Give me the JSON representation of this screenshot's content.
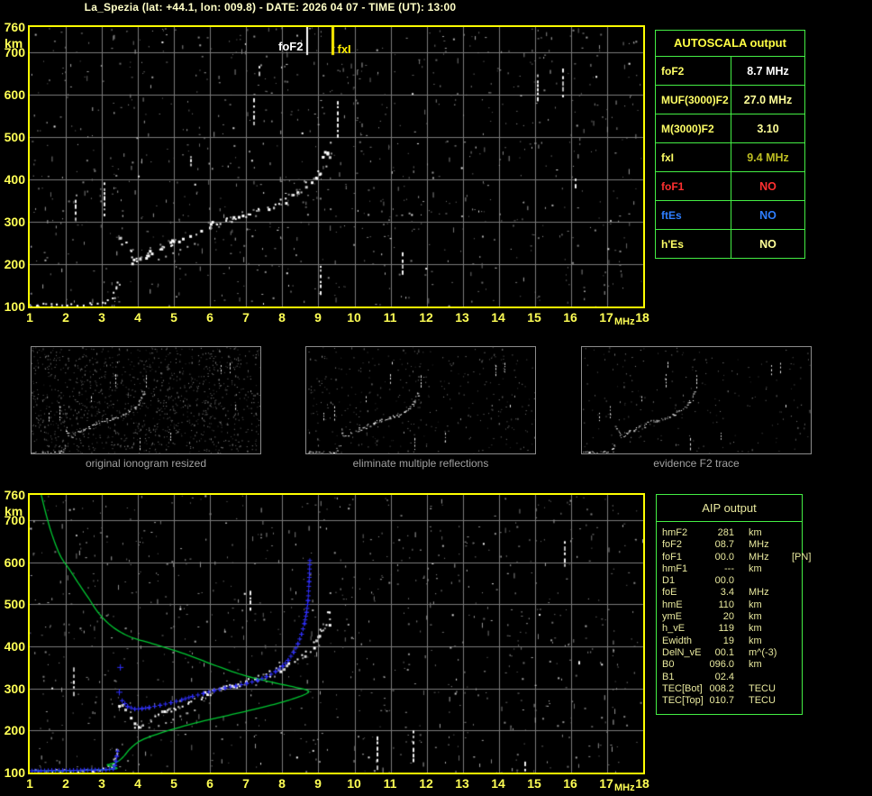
{
  "title": "La_Spezia (lat: +44.1, lon: 009.8) - DATE: 2026 04 07 - TIME (UT): 13:00",
  "colors": {
    "background": "#000000",
    "plot_border": "#ffff00",
    "grid": "#7b7b7b",
    "axis_label": "#ffff55",
    "title": "#ffffc6",
    "table_border": "#44ee44",
    "profile_green": "#00c832",
    "aip_trace_blue": "#3030ff",
    "echo_white": "#ffffff",
    "caption_gray": "#a0a0a0",
    "aip_text": "#e9e99e"
  },
  "autoscala_table": {
    "header": "AUTOSCALA output",
    "header_color": "#ffff44",
    "rows": [
      {
        "label": "foF2",
        "value": "8.7 MHz",
        "label_color": "#ffff66",
        "value_color": "#ffffff"
      },
      {
        "label": "MUF(3000)F2",
        "value": "27.0 MHz",
        "label_color": "#ffff66",
        "value_color": "#ffff99"
      },
      {
        "label": "M(3000)F2",
        "value": "3.10",
        "label_color": "#ffff66",
        "value_color": "#ffff99"
      },
      {
        "label": "fxI",
        "value": "9.4 MHz",
        "label_color": "#ffff66",
        "value_color": "#bdbd22"
      },
      {
        "label": "foF1",
        "value": "NO",
        "label_color": "#ff3030",
        "value_color": "#ff3030"
      },
      {
        "label": "ftEs",
        "value": "NO",
        "label_color": "#2e7eff",
        "value_color": "#2e7eff"
      },
      {
        "label": "h'Es",
        "value": "NO",
        "label_color": "#ffff66",
        "value_color": "#ffff99"
      }
    ]
  },
  "aip_table": {
    "header": "AIP output",
    "rows": [
      {
        "name": "hmF2",
        "value": "281",
        "unit": "km",
        "extra": ""
      },
      {
        "name": "foF2",
        "value": "08.7",
        "unit": "MHz",
        "extra": ""
      },
      {
        "name": "foF1",
        "value": "00.0",
        "unit": "MHz",
        "extra": "[PN]"
      },
      {
        "name": "hmF1",
        "value": "---",
        "unit": "km",
        "extra": ""
      },
      {
        "name": "D1",
        "value": "00.0",
        "unit": "",
        "extra": ""
      },
      {
        "name": "foE",
        "value": "3.4",
        "unit": "MHz",
        "extra": ""
      },
      {
        "name": "hmE",
        "value": "110",
        "unit": "km",
        "extra": ""
      },
      {
        "name": "ymE",
        "value": "20",
        "unit": "km",
        "extra": ""
      },
      {
        "name": "h_vE",
        "value": "119",
        "unit": "km",
        "extra": ""
      },
      {
        "name": "Ewidth",
        "value": "19",
        "unit": "km",
        "extra": ""
      },
      {
        "name": "DelN_vE",
        "value": "00.1",
        "unit": "m^(-3)",
        "extra": ""
      },
      {
        "name": "B0",
        "value": "096.0",
        "unit": "km",
        "extra": ""
      },
      {
        "name": "B1",
        "value": "02.4",
        "unit": "",
        "extra": ""
      },
      {
        "name": "TEC[Bot]",
        "value": "008.2",
        "unit": "TECU",
        "extra": ""
      },
      {
        "name": "TEC[Top]",
        "value": "010.7",
        "unit": "TECU",
        "extra": ""
      }
    ]
  },
  "thumbnails": [
    {
      "caption": "original ionogram resized"
    },
    {
      "caption": "eliminate multiple reflections"
    },
    {
      "caption": "evidence F2 trace"
    }
  ],
  "chart_data": {
    "type": "scatter",
    "xlabel": "MHz",
    "ylabel": "km",
    "xlim": [
      1,
      18
    ],
    "ylim": [
      100,
      760
    ],
    "xticks": [
      1,
      2,
      3,
      4,
      5,
      6,
      7,
      8,
      9,
      10,
      11,
      12,
      13,
      14,
      15,
      16,
      17,
      18
    ],
    "yticks": [
      760,
      700,
      600,
      500,
      400,
      300,
      200,
      100
    ],
    "grid": true,
    "markers": [
      {
        "label": "foF2",
        "freq": 8.7,
        "color": "#ffffff"
      },
      {
        "label": "fxI",
        "freq": 9.4,
        "color": "#ffee00"
      }
    ],
    "echo_trace": {
      "E_region": [
        [
          1.0,
          104
        ],
        [
          1.12,
          106
        ],
        [
          1.25,
          104
        ],
        [
          1.4,
          107
        ],
        [
          1.55,
          105
        ],
        [
          1.7,
          106
        ],
        [
          1.85,
          104
        ],
        [
          2.0,
          107
        ],
        [
          2.15,
          105
        ],
        [
          2.3,
          106
        ],
        [
          2.45,
          104
        ],
        [
          2.6,
          107
        ],
        [
          2.75,
          106
        ],
        [
          2.9,
          108
        ],
        [
          3.05,
          110
        ],
        [
          3.2,
          114
        ],
        [
          3.3,
          122
        ],
        [
          3.35,
          133
        ],
        [
          3.4,
          146
        ],
        [
          3.43,
          156
        ]
      ],
      "F_region": [
        [
          3.55,
          262
        ],
        [
          3.62,
          248
        ],
        [
          3.7,
          232
        ],
        [
          3.8,
          216
        ],
        [
          3.9,
          209
        ],
        [
          4.0,
          211
        ],
        [
          4.12,
          217
        ],
        [
          4.25,
          224
        ],
        [
          4.4,
          231
        ],
        [
          4.55,
          238
        ],
        [
          4.7,
          244
        ],
        [
          4.85,
          249
        ],
        [
          5.0,
          254
        ],
        [
          5.15,
          259
        ],
        [
          5.3,
          264
        ],
        [
          5.5,
          271
        ],
        [
          5.7,
          278
        ],
        [
          5.9,
          290
        ],
        [
          6.05,
          297
        ],
        [
          6.2,
          300
        ],
        [
          6.35,
          303
        ],
        [
          6.5,
          306
        ],
        [
          6.65,
          309
        ],
        [
          6.8,
          312
        ],
        [
          6.95,
          316
        ],
        [
          7.1,
          320
        ],
        [
          7.25,
          325
        ],
        [
          7.4,
          329
        ],
        [
          7.55,
          333
        ],
        [
          7.7,
          338
        ],
        [
          7.85,
          345
        ],
        [
          8.0,
          352
        ],
        [
          8.15,
          359
        ],
        [
          8.3,
          366
        ],
        [
          8.45,
          374
        ],
        [
          8.6,
          383
        ],
        [
          8.72,
          391
        ],
        [
          8.84,
          400
        ],
        [
          8.95,
          411
        ],
        [
          9.04,
          424
        ],
        [
          9.12,
          438
        ],
        [
          9.19,
          453
        ],
        [
          9.25,
          468
        ],
        [
          9.3,
          484
        ]
      ],
      "F_secondary": [
        [
          4.55,
          213
        ],
        [
          4.75,
          220
        ],
        [
          4.95,
          228
        ],
        [
          5.15,
          236
        ],
        [
          5.35,
          243
        ],
        [
          5.55,
          250
        ]
      ]
    },
    "interference_streaks": {
      "top_panel": [
        [
          2.25,
          300,
          352
        ],
        [
          3.05,
          312,
          393
        ],
        [
          5.45,
          428,
          455
        ],
        [
          7.2,
          522,
          592
        ],
        [
          7.35,
          645,
          668
        ],
        [
          9.05,
          125,
          196
        ],
        [
          9.5,
          498,
          585
        ],
        [
          11.3,
          178,
          228
        ],
        [
          15.05,
          590,
          648
        ],
        [
          15.75,
          598,
          662
        ],
        [
          16.1,
          378,
          402
        ]
      ],
      "bottom_panel": [
        [
          2.2,
          285,
          350
        ],
        [
          7.1,
          480,
          532
        ],
        [
          10.6,
          114,
          186
        ],
        [
          11.6,
          130,
          200
        ],
        [
          14.7,
          104,
          126
        ],
        [
          15.8,
          588,
          650
        ],
        [
          16.2,
          350,
          365
        ]
      ]
    },
    "profile_green": [
      [
        1.32,
        760
      ],
      [
        1.45,
        715
      ],
      [
        1.62,
        665
      ],
      [
        1.85,
        615
      ],
      [
        2.1,
        583
      ],
      [
        2.35,
        550
      ],
      [
        2.62,
        516
      ],
      [
        2.92,
        478
      ],
      [
        3.3,
        446
      ],
      [
        3.8,
        422
      ],
      [
        4.5,
        404
      ],
      [
        5.3,
        382
      ],
      [
        6.1,
        356
      ],
      [
        6.9,
        332
      ],
      [
        7.7,
        315
      ],
      [
        8.35,
        303
      ],
      [
        8.68,
        296
      ],
      [
        8.72,
        291
      ],
      [
        8.55,
        283
      ],
      [
        8.1,
        270
      ],
      [
        7.4,
        254
      ],
      [
        6.5,
        236
      ],
      [
        5.6,
        218
      ],
      [
        4.7,
        196
      ],
      [
        4.1,
        177
      ],
      [
        3.8,
        158
      ],
      [
        3.62,
        140
      ],
      [
        3.5,
        130
      ],
      [
        3.38,
        124
      ],
      [
        3.22,
        120
      ],
      [
        3.15,
        118
      ],
      [
        3.3,
        114
      ],
      [
        3.42,
        110
      ],
      [
        3.28,
        108
      ],
      [
        2.9,
        106
      ],
      [
        2.3,
        105
      ],
      [
        1.6,
        104
      ],
      [
        1.05,
        104
      ]
    ],
    "aip_trace_blue": {
      "E": [
        [
          1.05,
          105
        ],
        [
          1.3,
          105
        ],
        [
          1.6,
          106
        ],
        [
          1.9,
          106
        ],
        [
          2.2,
          106
        ],
        [
          2.5,
          107
        ],
        [
          2.8,
          107
        ],
        [
          3.1,
          108
        ],
        [
          3.3,
          110
        ],
        [
          3.35,
          118
        ],
        [
          3.38,
          128
        ],
        [
          3.4,
          140
        ],
        [
          3.42,
          152
        ]
      ],
      "F": [
        [
          3.55,
          272
        ],
        [
          3.7,
          258
        ],
        [
          3.9,
          252
        ],
        [
          4.1,
          253
        ],
        [
          4.3,
          256
        ],
        [
          4.6,
          261
        ],
        [
          4.9,
          267
        ],
        [
          5.2,
          274
        ],
        [
          5.5,
          282
        ],
        [
          5.8,
          289
        ],
        [
          6.1,
          296
        ],
        [
          6.4,
          302
        ],
        [
          6.7,
          307
        ],
        [
          7.0,
          313
        ],
        [
          7.3,
          320
        ],
        [
          7.55,
          329
        ],
        [
          7.8,
          341
        ],
        [
          8.0,
          354
        ],
        [
          8.15,
          368
        ],
        [
          8.3,
          387
        ],
        [
          8.42,
          407
        ],
        [
          8.52,
          430
        ],
        [
          8.6,
          455
        ],
        [
          8.66,
          482
        ],
        [
          8.7,
          510
        ],
        [
          8.73,
          555
        ],
        [
          8.75,
          605
        ]
      ],
      "isolated": [
        [
          3.47,
          292
        ],
        [
          3.5,
          351
        ]
      ]
    }
  }
}
